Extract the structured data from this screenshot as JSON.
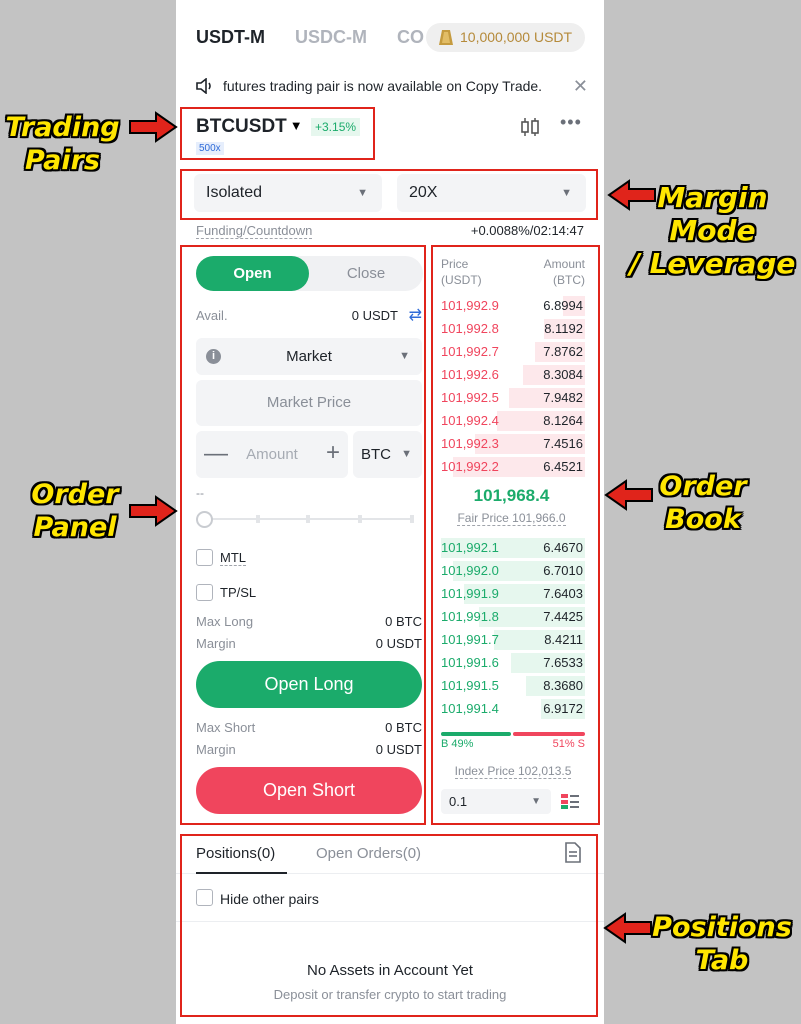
{
  "market_tabs": {
    "usdt_m": "USDT-M",
    "usdc_m": "USDC-M",
    "coin_m_partial": "CO",
    "promo": "10,000,000 USDT"
  },
  "notice": {
    "text": "futures trading pair is now available on Copy Trade.",
    "close": "✕"
  },
  "pair": {
    "name": "BTCUSDT",
    "change": "+3.15%",
    "leverage_badge": "500x"
  },
  "margin": {
    "mode": "Isolated",
    "leverage": "20X"
  },
  "funding": {
    "label": "Funding/Countdown",
    "value": "+0.0088%/02:14:47"
  },
  "order_panel": {
    "open_tab": "Open",
    "close_tab": "Close",
    "avail_label": "Avail.",
    "avail_value": "0 USDT",
    "order_type": "Market",
    "price_placeholder": "Market Price",
    "amount_placeholder": "Amount",
    "amount_unit": "BTC",
    "slider_value": "--",
    "mtl_label": "MTL",
    "tpsl_label": "TP/SL",
    "max_long_label": "Max Long",
    "max_long_value": "0 BTC",
    "margin_label": "Margin",
    "margin_long_value": "0 USDT",
    "open_long": "Open Long",
    "max_short_label": "Max Short",
    "max_short_value": "0 BTC",
    "margin_short_value": "0 USDT",
    "open_short": "Open Short"
  },
  "order_book": {
    "price_header": "Price",
    "price_unit": "(USDT)",
    "amount_header": "Amount",
    "amount_unit": "(BTC)",
    "asks": [
      {
        "price": "101,992.9",
        "amount": "6.8994",
        "depth": 0.15
      },
      {
        "price": "101,992.8",
        "amount": "8.1192",
        "depth": 0.28
      },
      {
        "price": "101,992.7",
        "amount": "7.8762",
        "depth": 0.34
      },
      {
        "price": "101,992.6",
        "amount": "8.3084",
        "depth": 0.42
      },
      {
        "price": "101,992.5",
        "amount": "7.9482",
        "depth": 0.52
      },
      {
        "price": "101,992.4",
        "amount": "8.1264",
        "depth": 0.6
      },
      {
        "price": "101,992.3",
        "amount": "7.4516",
        "depth": 0.75
      },
      {
        "price": "101,992.2",
        "amount": "6.4521",
        "depth": 0.9
      }
    ],
    "mid_price": "101,968.4",
    "fair_price": "Fair Price 101,966.0",
    "bids": [
      {
        "price": "101,992.1",
        "amount": "6.4670",
        "depth": 0.98
      },
      {
        "price": "101,992.0",
        "amount": "6.7010",
        "depth": 0.9
      },
      {
        "price": "101,991.9",
        "amount": "7.6403",
        "depth": 0.82
      },
      {
        "price": "101,991.8",
        "amount": "7.4425",
        "depth": 0.72
      },
      {
        "price": "101,991.7",
        "amount": "8.4211",
        "depth": 0.62
      },
      {
        "price": "101,991.6",
        "amount": "7.6533",
        "depth": 0.5
      },
      {
        "price": "101,991.5",
        "amount": "8.3680",
        "depth": 0.4
      },
      {
        "price": "101,991.4",
        "amount": "6.9172",
        "depth": 0.3
      }
    ],
    "buy_ratio": "B 49%",
    "sell_ratio": "51% S",
    "index_price": "Index Price 102,013.5",
    "precision": "0.1"
  },
  "positions": {
    "tab_positions": "Positions(0)",
    "tab_orders": "Open Orders(0)",
    "hide_other_pairs": "Hide other pairs",
    "empty_title": "No Assets in Account Yet",
    "empty_subtitle": "Deposit or transfer crypto to start trading"
  },
  "annotations": {
    "trading_pairs": "Trading\nPairs",
    "margin_mode": "Margin\nMode\n/ Leverage",
    "order_panel": "Order\nPanel",
    "order_book": "Order\nBook",
    "positions_tab": "Positions\nTab"
  },
  "colors": {
    "buy": "#1bab6b",
    "sell": "#f0455d",
    "annotation_box": "#e0241b",
    "annotation_text": "#ffe600"
  }
}
